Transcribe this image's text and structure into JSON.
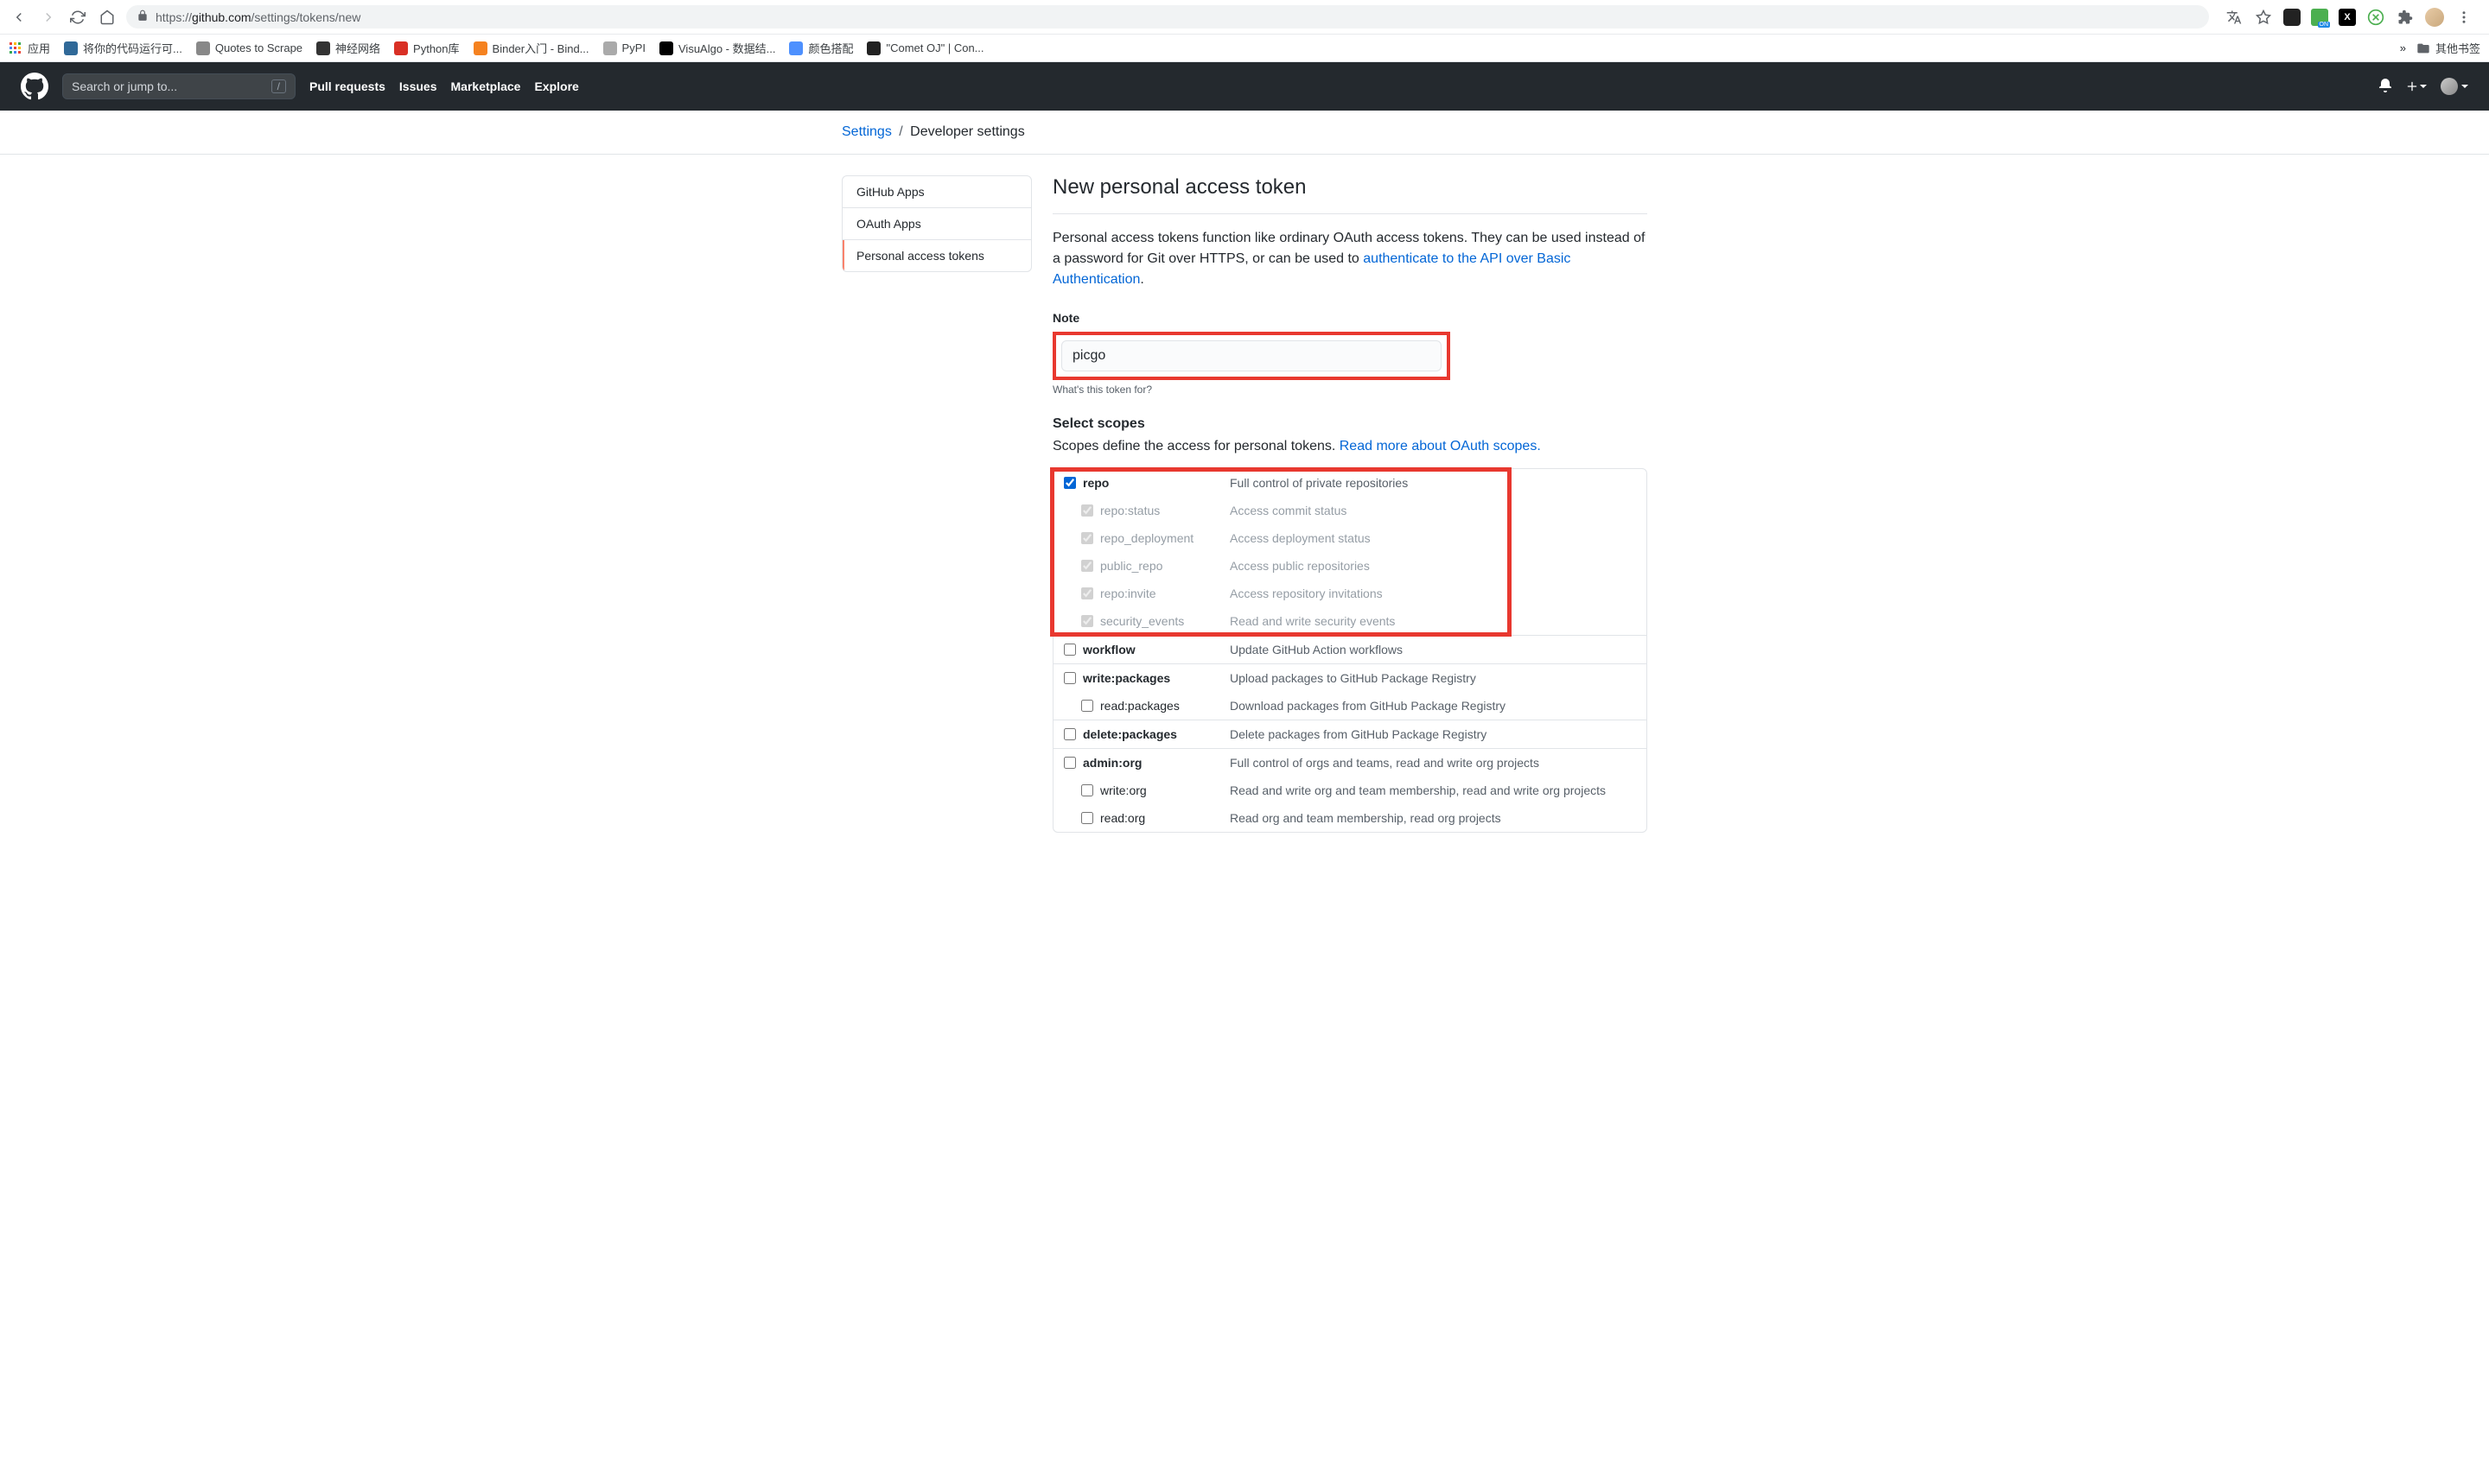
{
  "browser": {
    "url_prefix": "https://",
    "url_domain": "github.com",
    "url_path": "/settings/tokens/new",
    "bookmarks": [
      {
        "label": "应用",
        "color": "#ea4335"
      },
      {
        "label": "将你的代码运行可...",
        "color": "#306998"
      },
      {
        "label": "Quotes to Scrape",
        "color": "#888"
      },
      {
        "label": "神经网络",
        "color": "#333"
      },
      {
        "label": "Python库",
        "color": "#d93025"
      },
      {
        "label": "Binder入门 - Bind...",
        "color": "#f58220"
      },
      {
        "label": "PyPI",
        "color": "#aaa"
      },
      {
        "label": "VisuAlgo - 数据结...",
        "color": "#000"
      },
      {
        "label": "颜色搭配",
        "color": "#4d90fe"
      },
      {
        "label": "\"Comet OJ\" | Con...",
        "color": "#222"
      }
    ],
    "more": "»",
    "other_bookmarks": "其他书签"
  },
  "github_header": {
    "search_placeholder": "Search or jump to...",
    "nav": [
      "Pull requests",
      "Issues",
      "Marketplace",
      "Explore"
    ]
  },
  "breadcrumbs": {
    "root": "Settings",
    "current": "Developer settings"
  },
  "sidebar": {
    "items": [
      {
        "label": "GitHub Apps"
      },
      {
        "label": "OAuth Apps"
      },
      {
        "label": "Personal access tokens"
      }
    ]
  },
  "page": {
    "title": "New personal access token",
    "description_pre": "Personal access tokens function like ordinary OAuth access tokens. They can be used instead of a password for Git over HTTPS, or can be used to ",
    "description_link": "authenticate to the API over Basic Authentication",
    "description_post": ".",
    "note_label": "Note",
    "note_value": "picgo",
    "note_hint": "What's this token for?",
    "scopes_label": "Select scopes",
    "scopes_desc_pre": "Scopes define the access for personal tokens. ",
    "scopes_desc_link": "Read more about OAuth scopes.",
    "scopes": [
      {
        "name": "repo",
        "desc": "Full control of private repositories",
        "checked": true,
        "highlighted": true,
        "children": [
          {
            "name": "repo:status",
            "desc": "Access commit status",
            "disabled": true
          },
          {
            "name": "repo_deployment",
            "desc": "Access deployment status",
            "disabled": true
          },
          {
            "name": "public_repo",
            "desc": "Access public repositories",
            "disabled": true
          },
          {
            "name": "repo:invite",
            "desc": "Access repository invitations",
            "disabled": true
          },
          {
            "name": "security_events",
            "desc": "Read and write security events",
            "disabled": true
          }
        ]
      },
      {
        "name": "workflow",
        "desc": "Update GitHub Action workflows",
        "checked": false,
        "children": []
      },
      {
        "name": "write:packages",
        "desc": "Upload packages to GitHub Package Registry",
        "checked": false,
        "children": [
          {
            "name": "read:packages",
            "desc": "Download packages from GitHub Package Registry"
          }
        ]
      },
      {
        "name": "delete:packages",
        "desc": "Delete packages from GitHub Package Registry",
        "checked": false,
        "children": []
      },
      {
        "name": "admin:org",
        "desc": "Full control of orgs and teams, read and write org projects",
        "checked": false,
        "children": [
          {
            "name": "write:org",
            "desc": "Read and write org and team membership, read and write org projects"
          },
          {
            "name": "read:org",
            "desc": "Read org and team membership, read org projects"
          }
        ]
      }
    ]
  }
}
